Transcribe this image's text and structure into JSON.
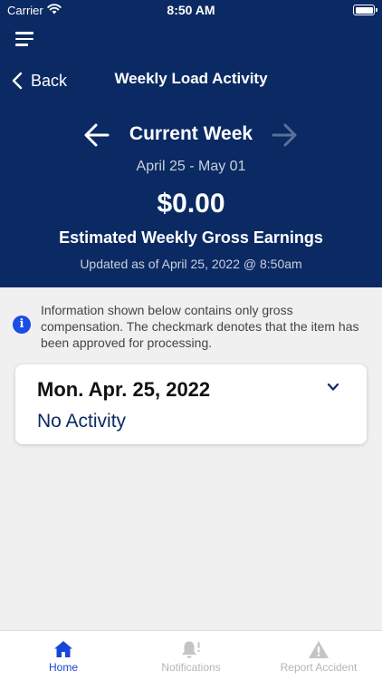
{
  "status_bar": {
    "carrier": "Carrier",
    "time": "8:50 AM"
  },
  "nav": {
    "back_label": "Back",
    "title": "Weekly Load Activity"
  },
  "week": {
    "label": "Current Week",
    "range": "April 25 - May 01",
    "amount": "$0.00",
    "earnings_label": "Estimated Weekly Gross Earnings",
    "updated": "Updated as of April 25, 2022 @ 8:50am"
  },
  "info": {
    "icon": "i",
    "text": "Information shown below contains only gross compensation. The checkmark denotes that the item has been approved for processing."
  },
  "days": [
    {
      "date": "Mon. Apr. 25, 2022",
      "status": "No Activity"
    }
  ],
  "tabs": [
    {
      "label": "Home",
      "icon": "home-icon",
      "active": true
    },
    {
      "label": "Notifications",
      "icon": "bell-icon",
      "active": false
    },
    {
      "label": "Report Accident",
      "icon": "warning-icon",
      "active": false
    }
  ],
  "colors": {
    "header_bg": "#0b2a63",
    "accent": "#1846d6",
    "inactive_tab": "#b5b5b5",
    "background": "#f0f0f0"
  }
}
